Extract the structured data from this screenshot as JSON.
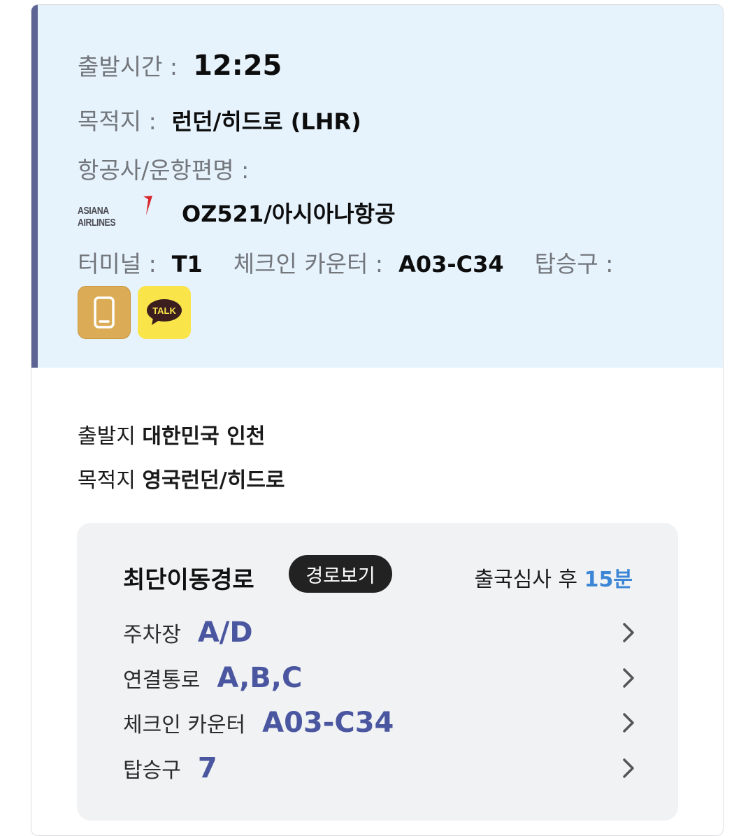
{
  "flight": {
    "departure_time_label": "출발시간 :",
    "departure_time": "12:25",
    "destination_label": "목적지 :",
    "destination": "런던/히드로 (LHR)",
    "airline_label": "항공사/운항편명 :",
    "airline_logo_text": "ASIANA AIRLINES",
    "flight_number": "OZ521/아시아나항공",
    "terminal_label": "터미널 :",
    "terminal": "T1",
    "checkin_label": "체크인 카운터 :",
    "checkin": "A03-C34",
    "gate_label": "탑승구 :",
    "talk_text": "TALK"
  },
  "origin": {
    "from_label": "출발지",
    "from_value": "대한민국 인천",
    "to_label": "목적지",
    "to_value": "영국런던/히드로"
  },
  "route": {
    "title": "최단이동경로",
    "view_button": "경로보기",
    "after_label": "출국심사 후",
    "after_value": "15분",
    "items": [
      {
        "label": "주차장",
        "value": "A/D"
      },
      {
        "label": "연결통로",
        "value": "A,B,C"
      },
      {
        "label": "체크인 카운터",
        "value": "A03-C34"
      },
      {
        "label": "탑승구",
        "value": "7"
      }
    ]
  },
  "colors": {
    "info_bg": "#e6f3fd",
    "accent_bar": "#5d6494",
    "route_value": "#4a57a0",
    "highlight_blue": "#3d86d6",
    "kakao_yellow": "#f9e44a",
    "phone_gold": "#dbac55"
  }
}
